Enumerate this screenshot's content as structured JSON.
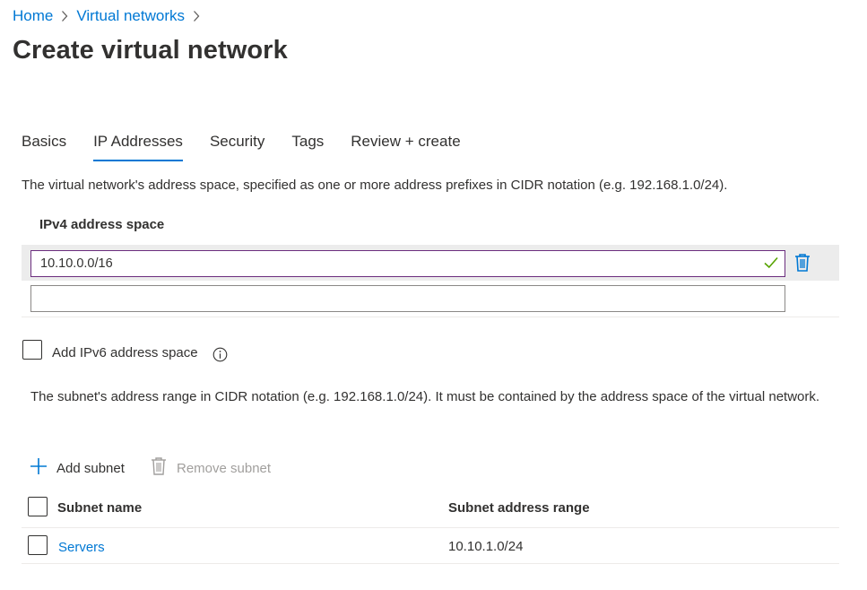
{
  "breadcrumb": {
    "items": [
      "Home",
      "Virtual networks"
    ]
  },
  "page": {
    "title": "Create virtual network"
  },
  "tabs": [
    {
      "label": "Basics",
      "active": false
    },
    {
      "label": "IP Addresses",
      "active": true
    },
    {
      "label": "Security",
      "active": false
    },
    {
      "label": "Tags",
      "active": false
    },
    {
      "label": "Review + create",
      "active": false
    }
  ],
  "address_space": {
    "description": "The virtual network's address space, specified as one or more address prefixes in CIDR notation (e.g. 192.168.1.0/24).",
    "header": "IPv4 address space",
    "entries": [
      {
        "value": "10.10.0.0/16",
        "valid": true
      },
      {
        "value": ""
      }
    ],
    "ipv6_checkbox_label": "Add IPv6 address space",
    "ipv6_checked": false
  },
  "subnets": {
    "description": "The subnet's address range in CIDR notation (e.g. 192.168.1.0/24). It must be contained by the address space of the virtual network.",
    "add_label": "Add subnet",
    "remove_label": "Remove subnet",
    "columns": [
      "Subnet name",
      "Subnet address range"
    ],
    "rows": [
      {
        "name": "Servers",
        "range": "10.10.1.0/24"
      }
    ]
  },
  "colors": {
    "accent": "#0078d4",
    "valid": "#57a300",
    "focus_border": "#6b2d7e",
    "disabled": "#a19f9d"
  }
}
